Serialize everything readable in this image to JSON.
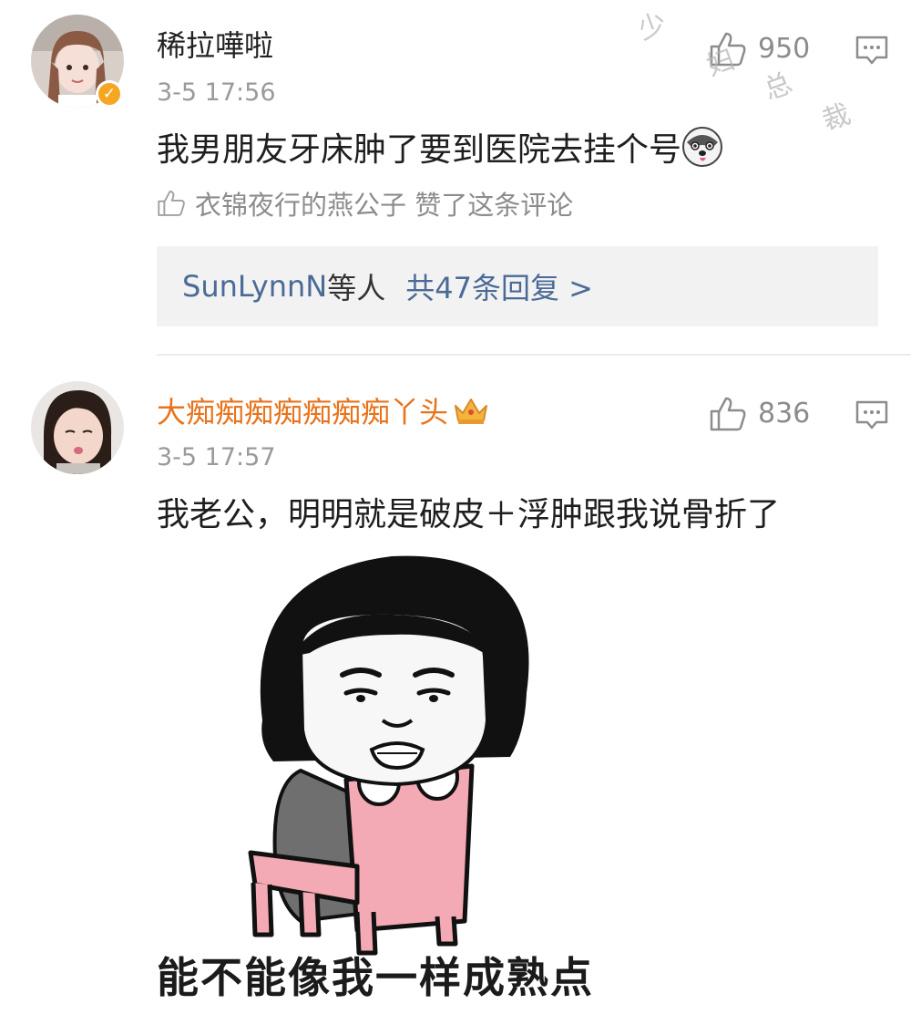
{
  "comments": [
    {
      "username": "稀拉嘩啦",
      "timestamp": "3-5 17:56",
      "likes": "950",
      "verified": true,
      "text": "我男朋友牙床肿了要到医院去挂个号",
      "emoji": "husky-face-emoji",
      "liked_by": "衣锦夜行的燕公子 赞了这条评论",
      "replies": {
        "names": "SunLynnN",
        "names_suffix": "等人",
        "count_label": "共47条回复 >"
      }
    },
    {
      "username": "大痴痴痴痴痴痴痴丫头",
      "timestamp": "3-5 17:57",
      "likes": "836",
      "vip": true,
      "text": "我老公，明明就是破皮＋浮肿跟我说骨折了",
      "meme_caption": "能不能像我一样成熟点"
    }
  ],
  "watermark": [
    "少",
    "妇",
    "总",
    "裁"
  ],
  "colors": {
    "vip_name": "#e8731c",
    "link": "#4b6a96",
    "secondary_text": "#8c8c8c",
    "badge": "#f5a623",
    "replies_bg": "#f2f2f2"
  },
  "icons": [
    "thumbs-up-icon",
    "comment-reply-icon",
    "verified-badge-icon",
    "crown-icon"
  ]
}
